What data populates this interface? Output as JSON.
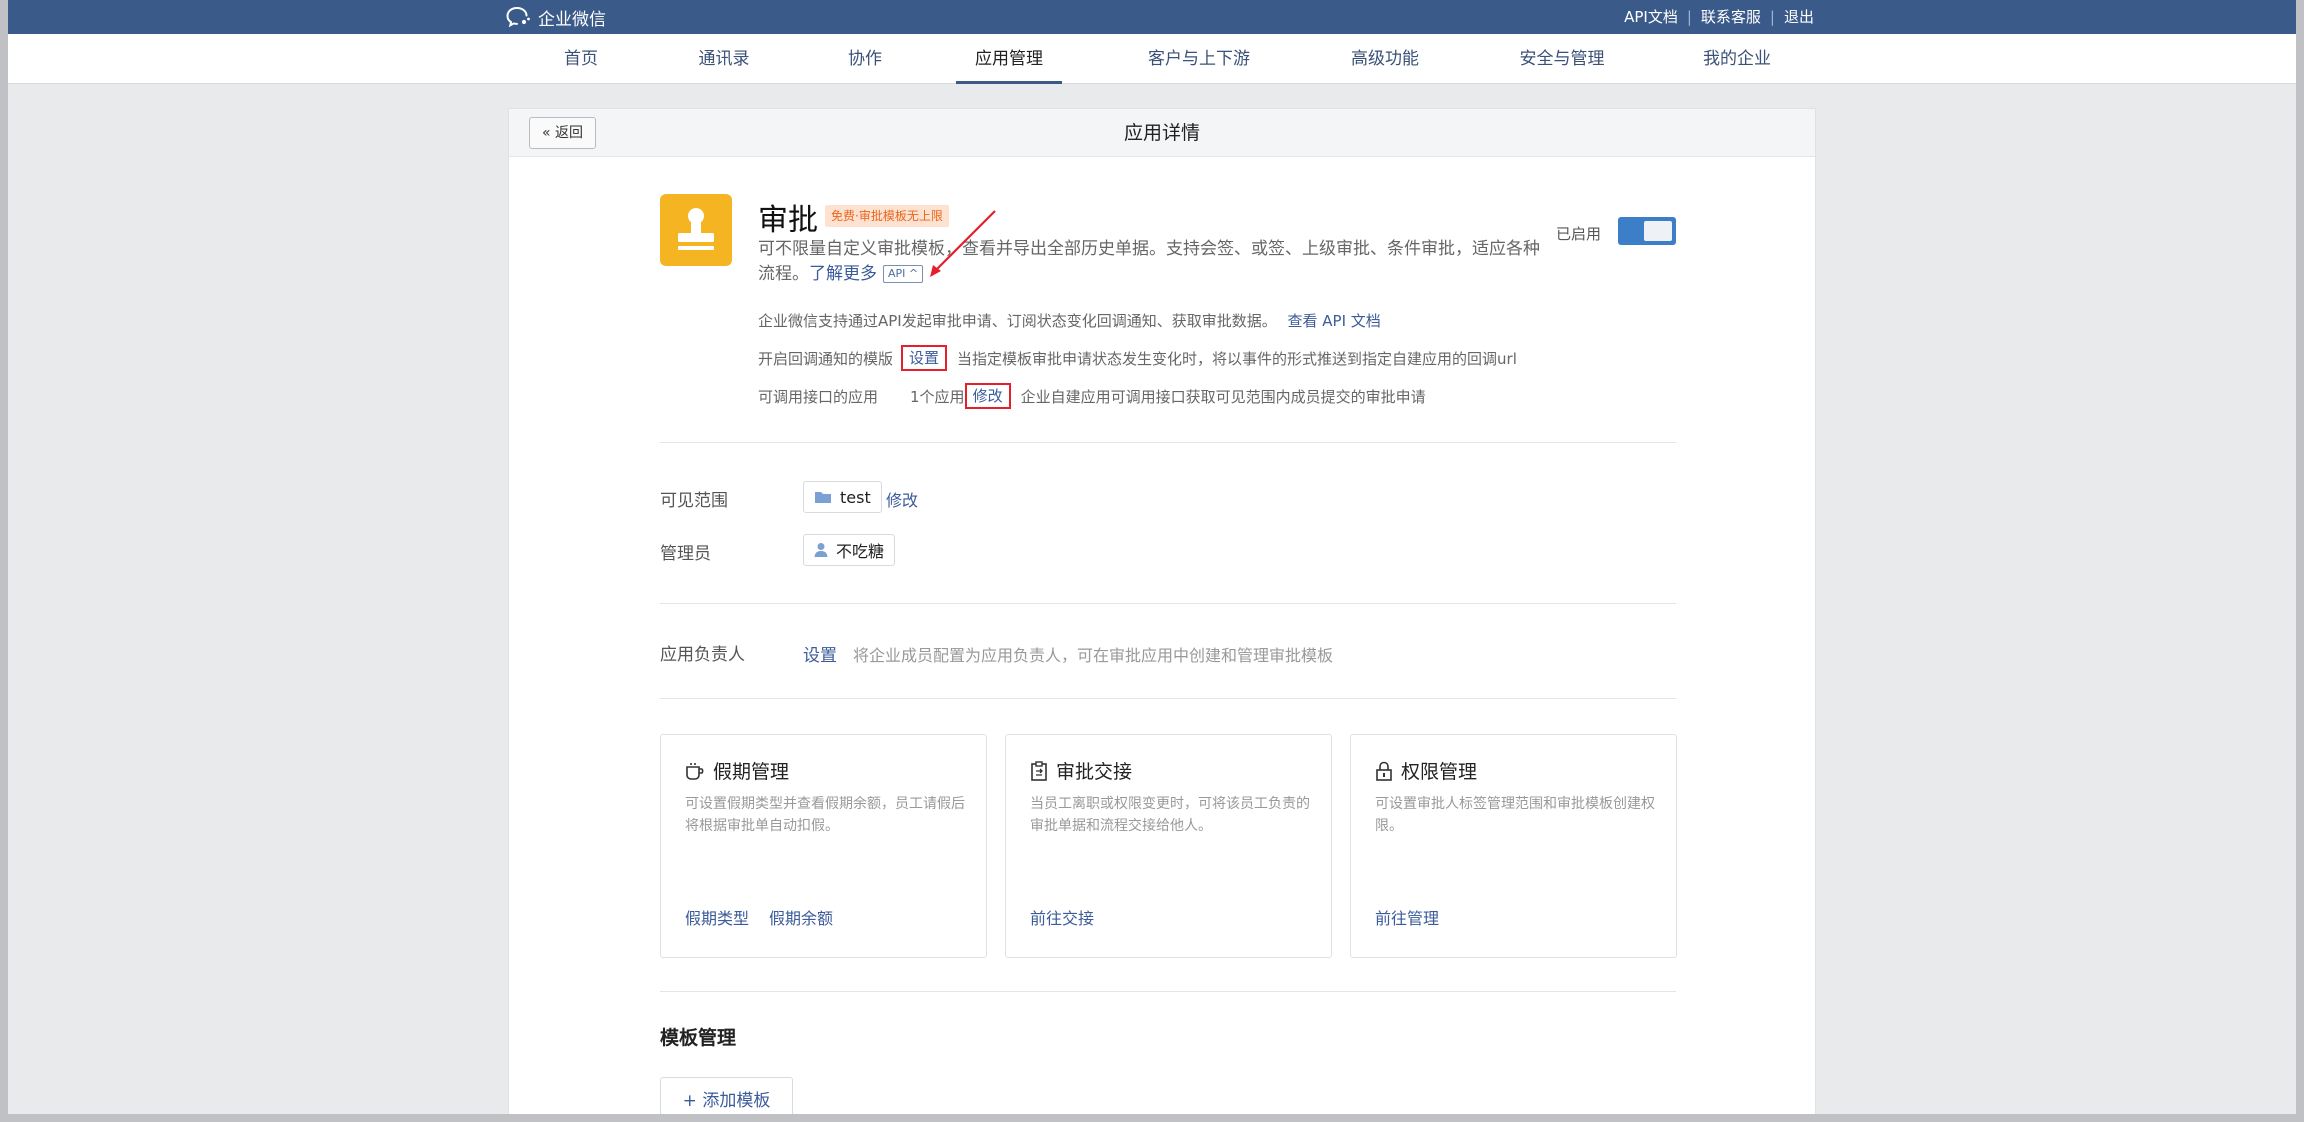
{
  "topbar": {
    "logo_text": "企业微信",
    "links": [
      "API文档",
      "联系客服",
      "退出"
    ],
    "separator": "|"
  },
  "nav": {
    "items": [
      "首页",
      "通讯录",
      "协作",
      "应用管理",
      "客户与上下游",
      "高级功能",
      "安全与管理",
      "我的企业"
    ],
    "active": "应用管理"
  },
  "header": {
    "back_label": "返回",
    "back_icon": "«",
    "title": "应用详情"
  },
  "app": {
    "name": "审批",
    "badge": "免费·审批模板无上限",
    "description": "可不限量自定义审批模板，查看并导出全部历史单据。支持会签、或签、上级审批、条件审批，适应各种流程。",
    "learn_more": "了解更多",
    "api_tag": "API ^",
    "status_label": "已启用",
    "enabled": true
  },
  "api_info": {
    "line1_text": "企业微信支持通过API发起审批申请、订阅状态变化回调通知、获取审批数据。",
    "line1_link": "查看 API 文档",
    "callback_label": "开启回调通知的模版",
    "callback_action": "设置",
    "callback_desc": "当指定模板审批申请状态发生变化时，将以事件的形式推送到指定自建应用的回调url",
    "callable_label": "可调用接口的应用",
    "callable_count": "1个应用",
    "callable_action": "修改",
    "callable_desc": "企业自建应用可调用接口获取可见范围内成员提交的审批申请"
  },
  "visibility": {
    "label": "可见范围",
    "chip": "test",
    "action": "修改"
  },
  "admin": {
    "label": "管理员",
    "chip": "不吃糖"
  },
  "owner": {
    "label": "应用负责人",
    "action": "设置",
    "desc": "将企业成员配置为应用负责人，可在审批应用中创建和管理审批模板"
  },
  "cards": [
    {
      "title": "假期管理",
      "desc": "可设置假期类型并查看假期余额，员工请假后将根据审批单自动扣假。",
      "links": [
        "假期类型",
        "假期余额"
      ]
    },
    {
      "title": "审批交接",
      "desc": "当员工离职或权限变更时，可将该员工负责的审批单据和流程交接给他人。",
      "links": [
        "前往交接"
      ]
    },
    {
      "title": "权限管理",
      "desc": "可设置审批人标签管理范围和审批模板创建权限。",
      "links": [
        "前往管理"
      ]
    }
  ],
  "templates": {
    "title": "模板管理",
    "add_label": "添加模板"
  },
  "colors": {
    "topbar": "#3a5a8a",
    "link": "#3b5b9a",
    "app_icon": "#f5b522",
    "badge_text": "#e8671d",
    "highlight": "#e3202c",
    "toggle": "#3d7ec9"
  }
}
